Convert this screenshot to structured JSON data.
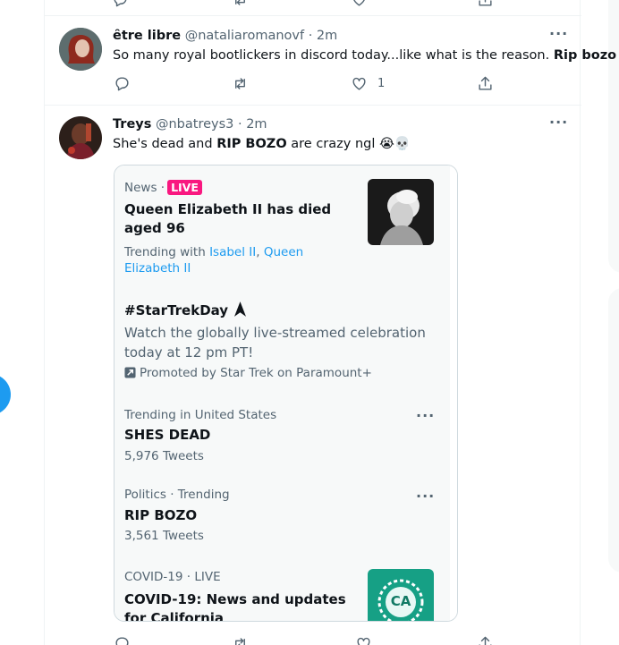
{
  "colors": {
    "accent": "#1d9bf0",
    "live_badge": "#f91880",
    "secondary_text": "#536471",
    "primary_text": "#0f1419",
    "covid_badge": "#16a085"
  },
  "tweets": [
    {
      "display_name": "ȇtre libre",
      "handle": "@nataliaromanovf",
      "time": "· 2m",
      "text_plain": "So many royal bootlickers in discord today...like what is the reason. ",
      "text_bold": "Rip bozo",
      "like_count": "1"
    },
    {
      "display_name": "Treys",
      "handle": "@nbatreys3",
      "time": "· 2m",
      "text_part1": "She's dead and ",
      "text_bold": "RIP BOZO",
      "text_part2": " are crazy ngl 😭💀"
    }
  ],
  "card": {
    "news": {
      "category": "News ·",
      "live_label": "LIVE",
      "headline": "Queen Elizabeth II has died aged 96",
      "trending_with_label": "Trending with ",
      "link1": "Isabel II",
      "separator": ", ",
      "link2": "Queen Elizabeth II"
    },
    "promoted": {
      "hashtag": "#StarTrekDay",
      "description": "Watch the globally live-streamed celebration today at 12 pm PT!",
      "promoted_by": "Promoted by Star Trek on Paramount+"
    },
    "trends": [
      {
        "context": "Trending in United States",
        "name": "SHES DEAD",
        "count": "5,976 Tweets"
      },
      {
        "context": "Politics · Trending",
        "name": "RIP BOZO",
        "count": "3,561 Tweets"
      }
    ],
    "covid": {
      "context": "COVID-19 · LIVE",
      "headline": "COVID-19: News and updates for California",
      "badge_text": "CA"
    }
  },
  "icons": {
    "reply": "reply-icon",
    "retweet": "retweet-icon",
    "like": "heart-icon",
    "share": "share-icon",
    "more": "more-icon",
    "promoted": "promoted-icon",
    "startrek": "startrek-delta-icon"
  }
}
